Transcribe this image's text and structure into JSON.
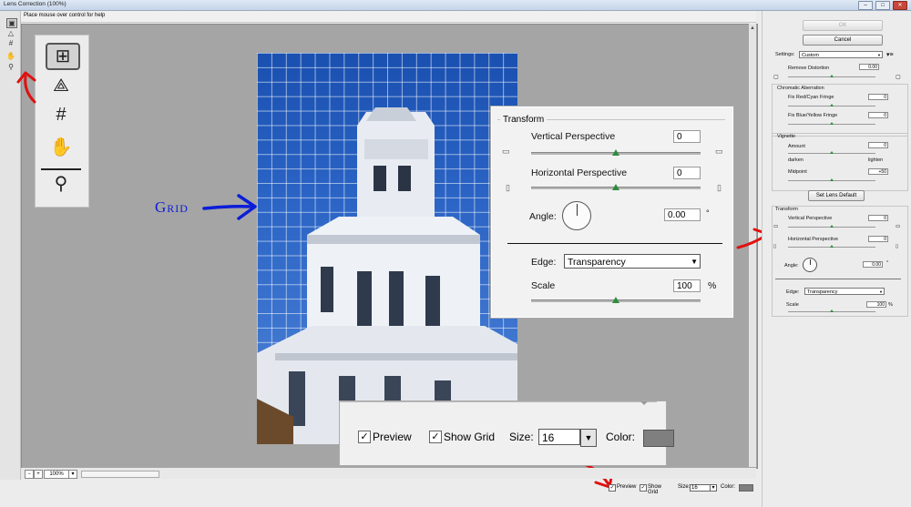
{
  "window": {
    "title": "Lens Correction (100%)",
    "help_text": "Place mouse over control for help",
    "minimize": "–",
    "maximize": "□",
    "close": "✕"
  },
  "toolbar_small": {
    "tools": [
      "remove-distortion-icon",
      "straighten-icon",
      "move-grid-icon",
      "hand-icon",
      "zoom-icon"
    ]
  },
  "zoomed_tools": {
    "tools": [
      "remove-distortion-icon",
      "straighten-icon",
      "move-grid-icon",
      "hand-icon",
      "zoom-icon"
    ]
  },
  "annotation": {
    "grid_label": "Grid",
    "arrow_color": "#e01010",
    "grid_arrow_color": "#0b1dd8"
  },
  "bottom": {
    "zoom_level": "100%",
    "zoom_out": "−",
    "zoom_in": "+"
  },
  "transform_zoom": {
    "title": "Transform",
    "vertical_perspective_label": "Vertical Perspective",
    "vertical_perspective_value": "0",
    "horizontal_perspective_label": "Horizontal Perspective",
    "horizontal_perspective_value": "0",
    "angle_label": "Angle:",
    "angle_value": "0.00",
    "angle_unit": "°",
    "edge_label": "Edge:",
    "edge_value": "Transparency",
    "scale_label": "Scale",
    "scale_value": "100",
    "scale_unit": "%"
  },
  "preview_zoom": {
    "preview_label": "Preview",
    "preview_checked": "✓",
    "show_grid_label": "Show Grid",
    "show_grid_checked": "✓",
    "size_label": "Size:",
    "size_value": "16",
    "color_label": "Color:",
    "grid_color": "#7f7f7f"
  },
  "statusbar": {
    "preview_label": "Preview",
    "show_grid_label": "Show Grid",
    "size_label": "Size:",
    "size_value": "16",
    "color_label": "Color:"
  },
  "right_panel": {
    "ok_label": "OK",
    "cancel_label": "Cancel",
    "settings_label": "Settings:",
    "settings_value": "Custom",
    "remove_distortion_label": "Remove Distortion",
    "remove_distortion_value": "0.00",
    "chromatic_title": "Chromatic Aberration",
    "red_cyan_label": "Fix Red/Cyan Fringe",
    "red_cyan_value": "0",
    "blue_yellow_label": "Fix Blue/Yellow Fringe",
    "blue_yellow_value": "0",
    "vignette_title": "Vignette",
    "amount_label": "Amount",
    "amount_value": "0",
    "darken_label": "darken",
    "lighten_label": "lighten",
    "midpoint_label": "Midpoint",
    "midpoint_value": "+50",
    "set_lens_default_label": "Set Lens Default",
    "transform_title": "Transform",
    "vertical_perspective_label": "Vertical Perspective",
    "vertical_perspective_value": "0",
    "horizontal_perspective_label": "Horizontal Perspective",
    "horizontal_perspective_value": "0",
    "angle_label": "Angle:",
    "angle_value": "0.00",
    "angle_unit": "°",
    "edge_label": "Edge:",
    "edge_value": "Transparency",
    "scale_label": "Scale",
    "scale_value": "100",
    "scale_unit": "%"
  }
}
